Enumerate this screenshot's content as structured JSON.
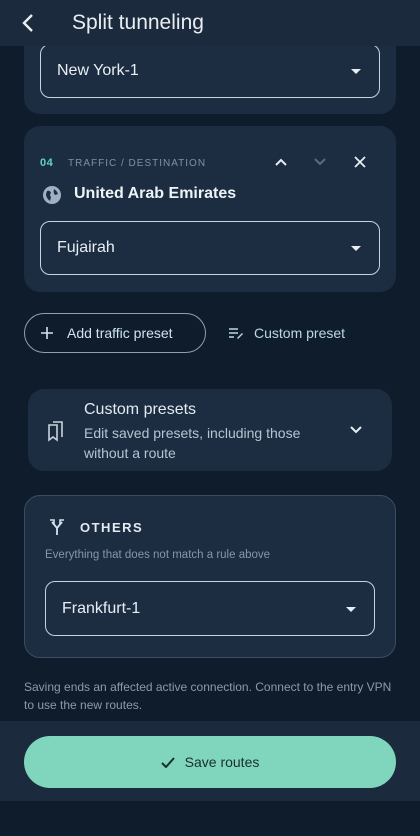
{
  "header": {
    "title": "Split tunneling",
    "back_icon": "back-arrow-icon"
  },
  "route3": {
    "selected_server": "New York-1"
  },
  "route4": {
    "index": "04",
    "label": "TRAFFIC / DESTINATION",
    "country": "United Arab Emirates",
    "selected_server": "Fujairah"
  },
  "actions": {
    "add_preset_label": "Add traffic preset",
    "custom_preset_label": "Custom preset"
  },
  "custom_presets": {
    "title": "Custom presets",
    "subtitle": "Edit saved presets, including those without a route"
  },
  "others": {
    "title": "OTHERS",
    "subtitle": "Everything that does not match a rule above",
    "selected_server": "Frankfurt-1"
  },
  "footer_note": "Saving ends an affected active connection. Connect to the entry VPN to use the new routes.",
  "save_button_label": "Save routes",
  "colors": {
    "accent": "#63d2bd",
    "save_button": "#7fd6bd",
    "card": "#1c2d42",
    "background": "#0f1c2b"
  }
}
